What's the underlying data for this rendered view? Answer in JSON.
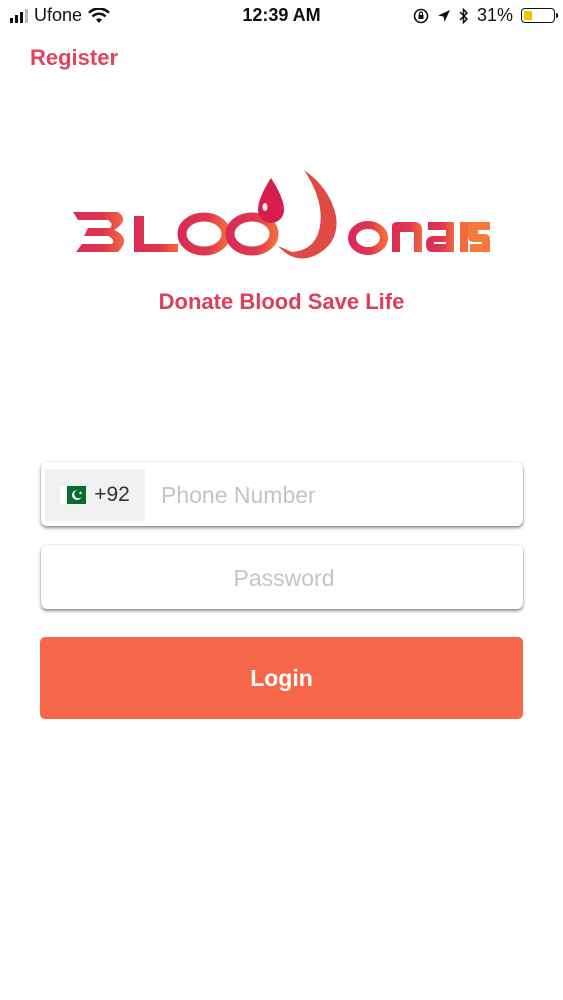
{
  "status_bar": {
    "carrier": "Ufone",
    "time": "12:39 AM",
    "battery_percent": "31%",
    "battery_level": 0.31,
    "battery_color": "#f5c400"
  },
  "header": {
    "register_label": "Register"
  },
  "logo": {
    "brand_text": "BLOODONARS",
    "tagline": "Donate Blood Save Life",
    "colors": {
      "primary": "#d92b57",
      "accent": "#f26a3d"
    }
  },
  "form": {
    "country_flag": "pakistan-flag-icon",
    "country_code": "+92",
    "phone_placeholder": "Phone Number",
    "phone_value": "",
    "password_placeholder": "Password",
    "password_value": "",
    "login_label": "Login"
  },
  "colors": {
    "brand": "#e0445e",
    "login_button": "#f6674a",
    "placeholder": "#c4c4c8"
  }
}
